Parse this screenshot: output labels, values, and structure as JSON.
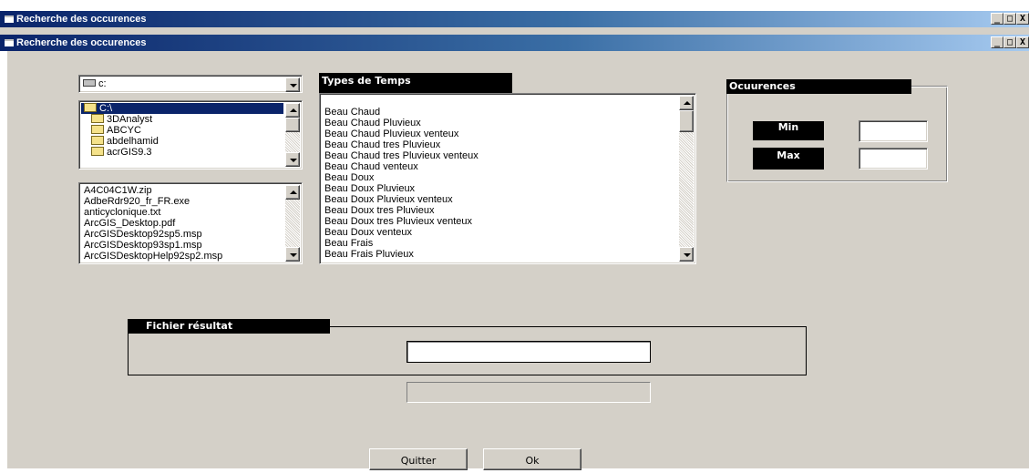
{
  "outer_window": {
    "title": "Recherche des occurences",
    "buttons": [
      "_",
      "□",
      "X"
    ]
  },
  "inner_window": {
    "title": "Recherche des occurences",
    "buttons": [
      "_",
      "□",
      "X"
    ]
  },
  "drive_select": {
    "value": "c:"
  },
  "dir_list": {
    "items": [
      {
        "label": "C:\\",
        "selected": true,
        "open": true
      },
      {
        "label": "3DAnalyst"
      },
      {
        "label": "ABCYC"
      },
      {
        "label": "abdelhamid"
      },
      {
        "label": "acrGIS9.3"
      }
    ]
  },
  "file_list": {
    "items": [
      "A4C04C1W.zip",
      "AdbeRdr920_fr_FR.exe",
      "anticyclonique.txt",
      "ArcGIS_Desktop.pdf",
      "ArcGISDesktop92sp5.msp",
      "ArcGISDesktop93sp1.msp",
      "ArcGISDesktopHelp92sp2.msp"
    ]
  },
  "types_temps": {
    "header": "Types de Temps",
    "items": [
      "Beau Chaud",
      "Beau Chaud Pluvieux",
      "Beau Chaud Pluvieux venteux",
      "Beau Chaud tres Pluvieux",
      "Beau Chaud tres Pluvieux venteux",
      "Beau Chaud venteux",
      "Beau Doux",
      "Beau Doux Pluvieux",
      "Beau Doux Pluvieux venteux",
      "Beau Doux tres Pluvieux",
      "Beau Doux tres Pluvieux venteux",
      "Beau Doux venteux",
      "Beau Frais",
      "Beau Frais Pluvieux"
    ]
  },
  "occurences": {
    "header": "Ocuurences",
    "min_label": "Min",
    "max_label": "Max",
    "min_value": "",
    "max_value": ""
  },
  "fichier": {
    "header": "Fichier résultat",
    "value": ""
  },
  "buttons": {
    "quit": "Quitter",
    "ok": "Ok"
  }
}
